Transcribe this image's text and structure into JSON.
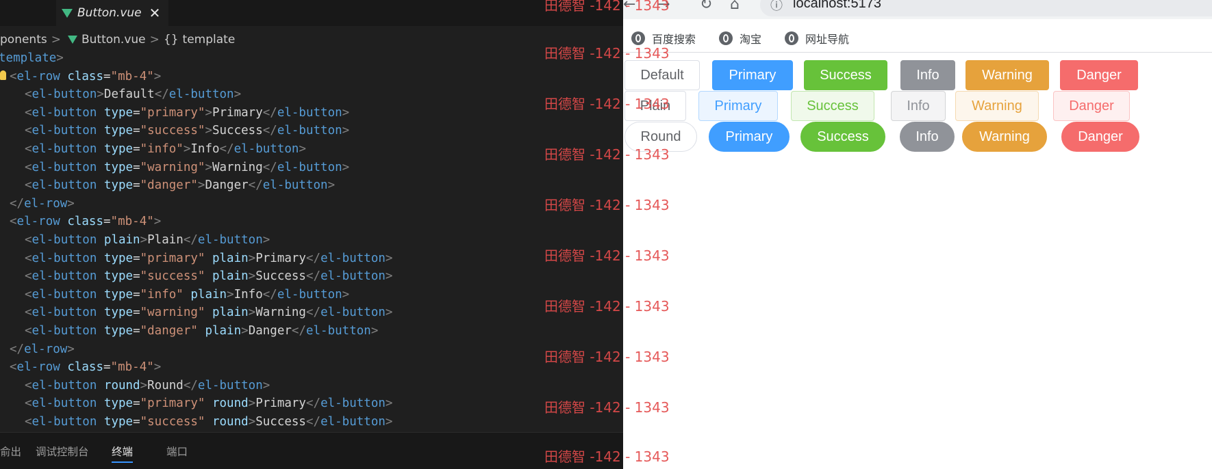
{
  "editor": {
    "tab": {
      "file_name": "Button.vue",
      "close": "✕"
    },
    "breadcrumb": {
      "folder": "ponents",
      "file": "Button.vue",
      "symbol": "template",
      "brace": "{}"
    },
    "lines": [
      {
        "indent": "",
        "parts": [
          [
            "t",
            "template"
          ],
          [
            "p",
            ">"
          ]
        ],
        "partial": true
      },
      {
        "indent": "",
        "parts": [
          [
            "p",
            "<"
          ],
          [
            "t",
            "el-row "
          ],
          [
            "a",
            "class"
          ],
          [
            "x",
            "="
          ],
          [
            "s",
            "\"mb-4\""
          ],
          [
            "p",
            ">"
          ]
        ]
      },
      {
        "indent": "  ",
        "parts": [
          [
            "p",
            "<"
          ],
          [
            "t",
            "el-button"
          ],
          [
            "p",
            ">"
          ],
          [
            "x",
            "Default"
          ],
          [
            "p",
            "</"
          ],
          [
            "t",
            "el-button"
          ],
          [
            "p",
            ">"
          ]
        ]
      },
      {
        "indent": "  ",
        "parts": [
          [
            "p",
            "<"
          ],
          [
            "t",
            "el-button "
          ],
          [
            "a",
            "type"
          ],
          [
            "x",
            "="
          ],
          [
            "s",
            "\"primary\""
          ],
          [
            "p",
            ">"
          ],
          [
            "x",
            "Primary"
          ],
          [
            "p",
            "</"
          ],
          [
            "t",
            "el-button"
          ],
          [
            "p",
            ">"
          ]
        ]
      },
      {
        "indent": "  ",
        "parts": [
          [
            "p",
            "<"
          ],
          [
            "t",
            "el-button "
          ],
          [
            "a",
            "type"
          ],
          [
            "x",
            "="
          ],
          [
            "s",
            "\"success\""
          ],
          [
            "p",
            ">"
          ],
          [
            "x",
            "Success"
          ],
          [
            "p",
            "</"
          ],
          [
            "t",
            "el-button"
          ],
          [
            "p",
            ">"
          ]
        ]
      },
      {
        "indent": "  ",
        "parts": [
          [
            "p",
            "<"
          ],
          [
            "t",
            "el-button "
          ],
          [
            "a",
            "type"
          ],
          [
            "x",
            "="
          ],
          [
            "s",
            "\"info\""
          ],
          [
            "p",
            ">"
          ],
          [
            "x",
            "Info"
          ],
          [
            "p",
            "</"
          ],
          [
            "t",
            "el-button"
          ],
          [
            "p",
            ">"
          ]
        ]
      },
      {
        "indent": "  ",
        "parts": [
          [
            "p",
            "<"
          ],
          [
            "t",
            "el-button "
          ],
          [
            "a",
            "type"
          ],
          [
            "x",
            "="
          ],
          [
            "s",
            "\"warning\""
          ],
          [
            "p",
            ">"
          ],
          [
            "x",
            "Warning"
          ],
          [
            "p",
            "</"
          ],
          [
            "t",
            "el-button"
          ],
          [
            "p",
            ">"
          ]
        ]
      },
      {
        "indent": "  ",
        "parts": [
          [
            "p",
            "<"
          ],
          [
            "t",
            "el-button "
          ],
          [
            "a",
            "type"
          ],
          [
            "x",
            "="
          ],
          [
            "s",
            "\"danger\""
          ],
          [
            "p",
            ">"
          ],
          [
            "x",
            "Danger"
          ],
          [
            "p",
            "</"
          ],
          [
            "t",
            "el-button"
          ],
          [
            "p",
            ">"
          ]
        ]
      },
      {
        "indent": "",
        "parts": [
          [
            "p",
            "</"
          ],
          [
            "t",
            "el-row"
          ],
          [
            "p",
            ">"
          ]
        ]
      },
      {
        "indent": "",
        "parts": [
          [
            "p",
            "<"
          ],
          [
            "t",
            "el-row "
          ],
          [
            "a",
            "class"
          ],
          [
            "x",
            "="
          ],
          [
            "s",
            "\"mb-4\""
          ],
          [
            "p",
            ">"
          ]
        ]
      },
      {
        "indent": "  ",
        "parts": [
          [
            "p",
            "<"
          ],
          [
            "t",
            "el-button "
          ],
          [
            "a",
            "plain"
          ],
          [
            "p",
            ">"
          ],
          [
            "x",
            "Plain"
          ],
          [
            "p",
            "</"
          ],
          [
            "t",
            "el-button"
          ],
          [
            "p",
            ">"
          ]
        ]
      },
      {
        "indent": "  ",
        "parts": [
          [
            "p",
            "<"
          ],
          [
            "t",
            "el-button "
          ],
          [
            "a",
            "type"
          ],
          [
            "x",
            "="
          ],
          [
            "s",
            "\"primary\""
          ],
          [
            "x",
            " "
          ],
          [
            "a",
            "plain"
          ],
          [
            "p",
            ">"
          ],
          [
            "x",
            "Primary"
          ],
          [
            "p",
            "</"
          ],
          [
            "t",
            "el-button"
          ],
          [
            "p",
            ">"
          ]
        ]
      },
      {
        "indent": "  ",
        "parts": [
          [
            "p",
            "<"
          ],
          [
            "t",
            "el-button "
          ],
          [
            "a",
            "type"
          ],
          [
            "x",
            "="
          ],
          [
            "s",
            "\"success\""
          ],
          [
            "x",
            " "
          ],
          [
            "a",
            "plain"
          ],
          [
            "p",
            ">"
          ],
          [
            "x",
            "Success"
          ],
          [
            "p",
            "</"
          ],
          [
            "t",
            "el-button"
          ],
          [
            "p",
            ">"
          ]
        ]
      },
      {
        "indent": "  ",
        "parts": [
          [
            "p",
            "<"
          ],
          [
            "t",
            "el-button "
          ],
          [
            "a",
            "type"
          ],
          [
            "x",
            "="
          ],
          [
            "s",
            "\"info\""
          ],
          [
            "x",
            " "
          ],
          [
            "a",
            "plain"
          ],
          [
            "p",
            ">"
          ],
          [
            "x",
            "Info"
          ],
          [
            "p",
            "</"
          ],
          [
            "t",
            "el-button"
          ],
          [
            "p",
            ">"
          ]
        ]
      },
      {
        "indent": "  ",
        "parts": [
          [
            "p",
            "<"
          ],
          [
            "t",
            "el-button "
          ],
          [
            "a",
            "type"
          ],
          [
            "x",
            "="
          ],
          [
            "s",
            "\"warning\""
          ],
          [
            "x",
            " "
          ],
          [
            "a",
            "plain"
          ],
          [
            "p",
            ">"
          ],
          [
            "x",
            "Warning"
          ],
          [
            "p",
            "</"
          ],
          [
            "t",
            "el-button"
          ],
          [
            "p",
            ">"
          ]
        ]
      },
      {
        "indent": "  ",
        "parts": [
          [
            "p",
            "<"
          ],
          [
            "t",
            "el-button "
          ],
          [
            "a",
            "type"
          ],
          [
            "x",
            "="
          ],
          [
            "s",
            "\"danger\""
          ],
          [
            "x",
            " "
          ],
          [
            "a",
            "plain"
          ],
          [
            "p",
            ">"
          ],
          [
            "x",
            "Danger"
          ],
          [
            "p",
            "</"
          ],
          [
            "t",
            "el-button"
          ],
          [
            "p",
            ">"
          ]
        ]
      },
      {
        "indent": "",
        "parts": [
          [
            "p",
            "</"
          ],
          [
            "t",
            "el-row"
          ],
          [
            "p",
            ">"
          ]
        ]
      },
      {
        "indent": "",
        "parts": [
          [
            "p",
            "<"
          ],
          [
            "t",
            "el-row "
          ],
          [
            "a",
            "class"
          ],
          [
            "x",
            "="
          ],
          [
            "s",
            "\"mb-4\""
          ],
          [
            "p",
            ">"
          ]
        ]
      },
      {
        "indent": "  ",
        "parts": [
          [
            "p",
            "<"
          ],
          [
            "t",
            "el-button "
          ],
          [
            "a",
            "round"
          ],
          [
            "p",
            ">"
          ],
          [
            "x",
            "Round"
          ],
          [
            "p",
            "</"
          ],
          [
            "t",
            "el-button"
          ],
          [
            "p",
            ">"
          ]
        ]
      },
      {
        "indent": "  ",
        "parts": [
          [
            "p",
            "<"
          ],
          [
            "t",
            "el-button "
          ],
          [
            "a",
            "type"
          ],
          [
            "x",
            "="
          ],
          [
            "s",
            "\"primary\""
          ],
          [
            "x",
            " "
          ],
          [
            "a",
            "round"
          ],
          [
            "p",
            ">"
          ],
          [
            "x",
            "Primary"
          ],
          [
            "p",
            "</"
          ],
          [
            "t",
            "el-button"
          ],
          [
            "p",
            ">"
          ]
        ]
      },
      {
        "indent": "  ",
        "parts": [
          [
            "p",
            "<"
          ],
          [
            "t",
            "el-button "
          ],
          [
            "a",
            "type"
          ],
          [
            "x",
            "="
          ],
          [
            "s",
            "\"success\""
          ],
          [
            "x",
            " "
          ],
          [
            "a",
            "round"
          ],
          [
            "p",
            ">"
          ],
          [
            "x",
            "Success"
          ],
          [
            "p",
            "</"
          ],
          [
            "t",
            "el-button"
          ],
          [
            "p",
            ">"
          ]
        ]
      }
    ],
    "panel_tabs": [
      {
        "label": "俞出",
        "active": false
      },
      {
        "label": "调试控制台",
        "active": false
      },
      {
        "label": "终端",
        "active": true
      },
      {
        "label": "端口",
        "active": false
      }
    ]
  },
  "watermark": {
    "text": "田德智 -142 - 1343",
    "count": 10
  },
  "browser": {
    "url": "localhost:5173",
    "nav_icons": [
      "back-icon",
      "forward-icon",
      "reload-icon",
      "home-icon",
      "info-icon"
    ],
    "bookmarks": [
      "百度搜索",
      "淘宝",
      "网址导航"
    ],
    "rows": [
      {
        "style": "default",
        "buttons": [
          "Default",
          "Primary",
          "Success",
          "Info",
          "Warning",
          "Danger"
        ]
      },
      {
        "style": "plain",
        "buttons": [
          "Plain",
          "Primary",
          "Success",
          "Info",
          "Warning",
          "Danger"
        ]
      },
      {
        "style": "round",
        "buttons": [
          "Round",
          "Primary",
          "Success",
          "Info",
          "Warning",
          "Danger"
        ]
      }
    ]
  },
  "colors": {
    "primary": "#409eff",
    "success": "#67c23a",
    "info": "#909399",
    "warning": "#e6a23c",
    "danger": "#f56c6c",
    "default_border": "#dcdfe6",
    "plain_primary_bg": "#ecf5ff",
    "plain_primary_border": "#b3d8ff",
    "plain_success_bg": "#f0f9eb",
    "plain_success_border": "#c2e7b0",
    "plain_info_bg": "#f4f4f5",
    "plain_info_border": "#d3d4d6",
    "plain_warning_bg": "#fdf6ec",
    "plain_warning_border": "#f5dab1",
    "plain_danger_bg": "#fef0f0",
    "plain_danger_border": "#fbc4c4",
    "watermark": "#e34b4b"
  }
}
